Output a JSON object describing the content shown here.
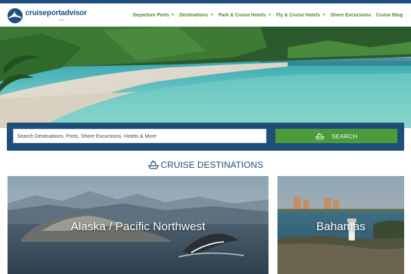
{
  "brand": {
    "name": "cruiseportadvisor",
    "sub": ".com"
  },
  "nav": {
    "items": [
      {
        "label": "Departure Ports",
        "has_dropdown": true
      },
      {
        "label": "Destinations",
        "has_dropdown": true
      },
      {
        "label": "Park & Cruise Hotels",
        "has_dropdown": true
      },
      {
        "label": "Fly & Cruise Hotels",
        "has_dropdown": true
      },
      {
        "label": "Shore Excursions",
        "has_dropdown": false
      },
      {
        "label": "Cruise Blog",
        "has_dropdown": false
      }
    ]
  },
  "search": {
    "placeholder": "Search Destinations, Ports, Shore Excursions, Hotels & More",
    "button_label": "SEARCH",
    "button_icon": "ship-icon"
  },
  "destinations": {
    "title": "CRUISE DESTINATIONS",
    "title_icon": "ship-icon",
    "cards": [
      {
        "label": "Alaska / Pacific Northwest"
      },
      {
        "label": "Bahamas"
      }
    ]
  },
  "colors": {
    "brand_blue": "#1d4f7e",
    "nav_green": "#4b8a2a",
    "search_button_green": "#4a9b3a",
    "search_bar_blue": "#1f4e78"
  }
}
